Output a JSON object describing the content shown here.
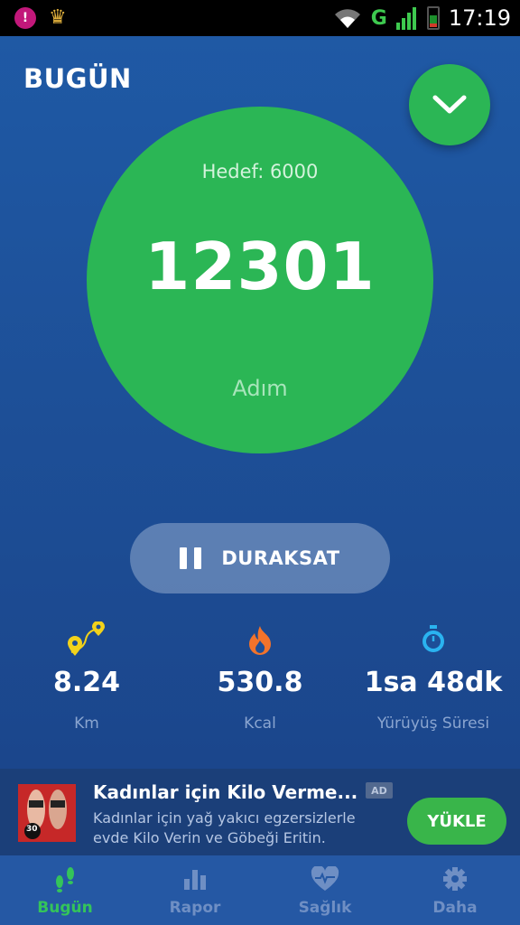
{
  "status_bar": {
    "time": "17:19",
    "network_label": "G",
    "app_icon_letter": "!"
  },
  "header": {
    "title": "BUGÜN",
    "expand_icon": "chevron-down-icon"
  },
  "progress": {
    "goal_label": "Hedef: 6000",
    "steps": "12301",
    "unit": "Adım"
  },
  "pause_button": {
    "label": "DURAKSAT",
    "icon": "pause-icon"
  },
  "stats": [
    {
      "icon": "route-pins-icon",
      "value": "8.24",
      "label": "Km",
      "color": "#f2d21b"
    },
    {
      "icon": "flame-icon",
      "value": "530.8",
      "label": "Kcal",
      "color": "#f2732b"
    },
    {
      "icon": "stopwatch-icon",
      "value": "1sa 48dk",
      "label": "Yürüyüş Süresi",
      "color": "#2ab3f0"
    }
  ],
  "ad": {
    "title": "Kadınlar için Kilo Verme...",
    "description": "Kadınlar için yağ yakıcı egzersizlerle evde Kilo Verin ve Göbeği Eritin.",
    "badge": "AD",
    "cta": "YÜKLE",
    "thumb_text": "30"
  },
  "bottom_nav": [
    {
      "label": "Bugün",
      "icon": "footsteps-icon",
      "active": true
    },
    {
      "label": "Rapor",
      "icon": "bar-chart-icon",
      "active": false
    },
    {
      "label": "Sağlık",
      "icon": "heart-pulse-icon",
      "active": false
    },
    {
      "label": "Daha",
      "icon": "gear-icon",
      "active": false
    }
  ],
  "colors": {
    "accent_green": "#2bb655",
    "background_blue": "#1f5aa6",
    "nav_bg": "#2558a4",
    "active_nav": "#34c45a"
  }
}
